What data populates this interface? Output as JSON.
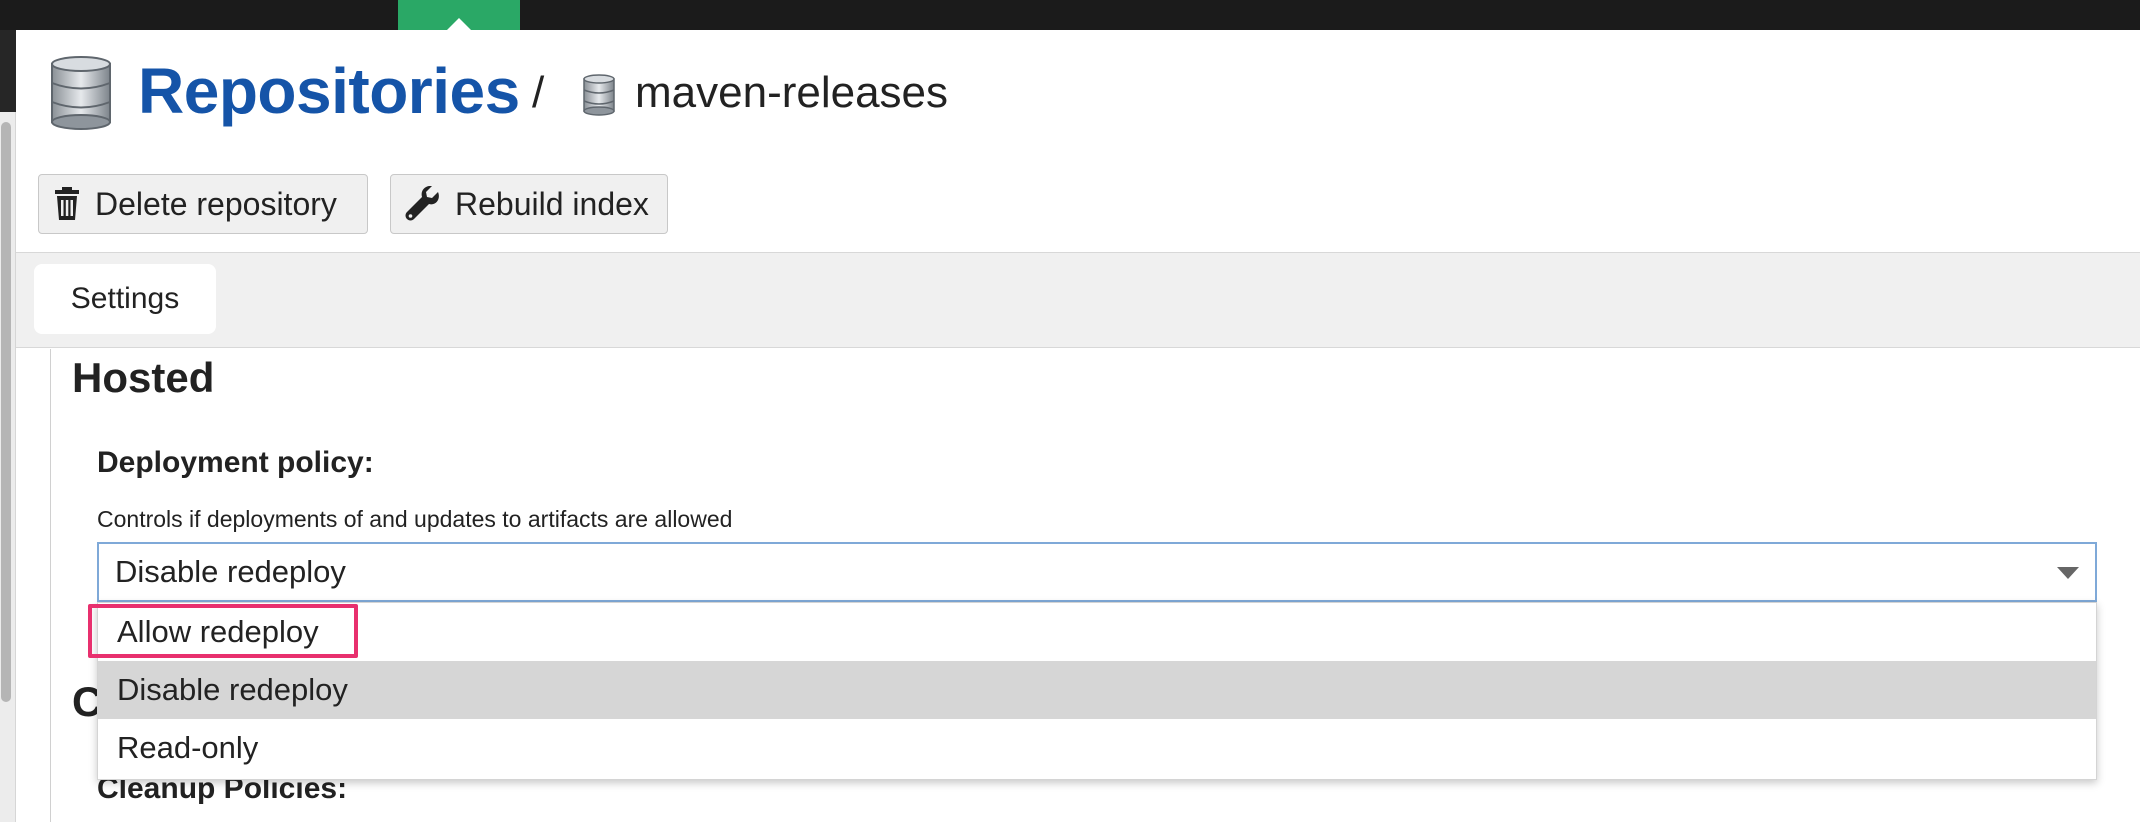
{
  "header": {
    "title": "Repositories",
    "separator": "/",
    "repository_name": "maven-releases"
  },
  "toolbar": {
    "delete_label": "Delete repository",
    "rebuild_label": "Rebuild index"
  },
  "tabs": [
    {
      "label": "Settings",
      "active": true
    }
  ],
  "section": {
    "title": "Hosted"
  },
  "deployment_policy": {
    "label": "Deployment policy:",
    "help": "Controls if deployments of and updates to artifacts are allowed",
    "selected": "Disable redeploy",
    "options": [
      "Allow redeploy",
      "Disable redeploy",
      "Read-only"
    ]
  },
  "obscured": {
    "section_initial": "C",
    "cleanup_label": "Cleanup Policies:"
  },
  "colors": {
    "title": "#1554a8",
    "active_nav": "#2aa866",
    "highlight": "#e8306e",
    "hover_option": "#d6d6d6"
  }
}
